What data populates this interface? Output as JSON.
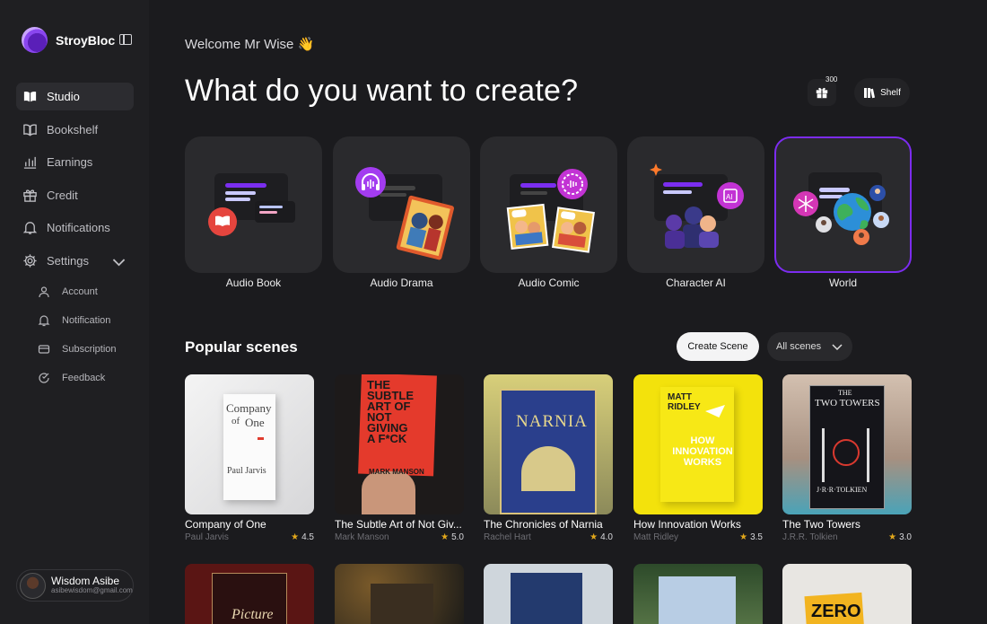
{
  "brand": {
    "name": "StroyBloc"
  },
  "sidebar": {
    "items": [
      {
        "label": "Studio",
        "icon": "book-open-icon"
      },
      {
        "label": "Bookshelf",
        "icon": "books-icon"
      },
      {
        "label": "Earnings",
        "icon": "bar-chart-icon"
      },
      {
        "label": "Credit",
        "icon": "gift-icon"
      },
      {
        "label": "Notifications",
        "icon": "bell-icon"
      },
      {
        "label": "Settings",
        "icon": "gear-icon"
      }
    ],
    "settings_sub": [
      {
        "label": "Account",
        "icon": "user-icon"
      },
      {
        "label": "Notification",
        "icon": "bell-icon"
      },
      {
        "label": "Subscription",
        "icon": "card-icon"
      },
      {
        "label": "Feedback",
        "icon": "feedback-icon"
      }
    ]
  },
  "user": {
    "name": "Wisdom Asibe",
    "email": "asibewisdom@gmail.com"
  },
  "header": {
    "welcome": "Welcome Mr Wise 👋",
    "headline": "What do you want to create?",
    "gift_count": "300",
    "shelf_label": "Shelf"
  },
  "categories": [
    {
      "label": "Audio Book"
    },
    {
      "label": "Audio Drama"
    },
    {
      "label": "Audio Comic"
    },
    {
      "label": "Character AI"
    },
    {
      "label": "World",
      "selected": true
    }
  ],
  "popular": {
    "title": "Popular scenes",
    "create_label": "Create Scene",
    "filter_value": "All scenes",
    "books": [
      {
        "title": "Company of One",
        "author": "Paul Jarvis",
        "rating": "4.5",
        "cover_text": [
          "Company",
          "of",
          "One",
          "Paul Jarvis"
        ]
      },
      {
        "title": "The Subtle Art of Not Giv...",
        "author": "Mark Manson",
        "rating": "5.0",
        "cover_text": [
          "THE",
          "SUBTLE",
          "ART OF",
          "NOT",
          "GIVING",
          "A F*CK",
          "MARK MANSON"
        ]
      },
      {
        "title": "The Chronicles of Narnia",
        "author": "Rachel Hart",
        "rating": "4.0",
        "cover_text": [
          "NARNIA"
        ]
      },
      {
        "title": "How Innovation Works",
        "author": "Matt Ridley",
        "rating": "3.5",
        "cover_text": [
          "MATT",
          "RIDLEY",
          "HOW",
          "INNOVATION",
          "WORKS"
        ]
      },
      {
        "title": "The Two Towers",
        "author": "J.R.R. Tolkien",
        "rating": "3.0",
        "cover_text": [
          "THE",
          "TWO TOWERS",
          "J·R·R·TOLKIEN"
        ]
      }
    ],
    "row2_cover_text": [
      "Picture",
      "ZERO"
    ]
  },
  "colors": {
    "accent": "#7c2cf0",
    "star": "#e3a81b"
  }
}
